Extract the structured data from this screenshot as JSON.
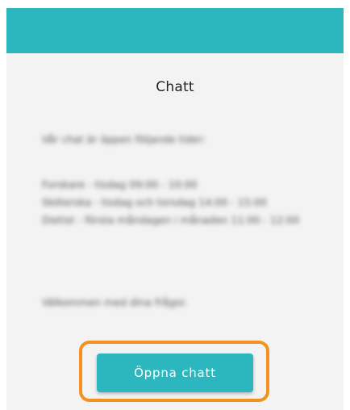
{
  "page": {
    "title": "Chatt"
  },
  "content": {
    "intro": "Vår chat är öppen följande tider:",
    "schedule": [
      "Forskare - tisdag 09:00 - 10:00",
      "Sköterska - tisdag och torsdag 14:00 - 15:00",
      "Dietist - första måndagen i månaden 11:00 - 12:00"
    ],
    "closing": "Välkommen med dina frågor."
  },
  "actions": {
    "open_chat_label": "Öppna chatt"
  },
  "colors": {
    "accent": "#2cb7bf",
    "highlight": "#f3921e",
    "background": "#f3f3f3"
  }
}
